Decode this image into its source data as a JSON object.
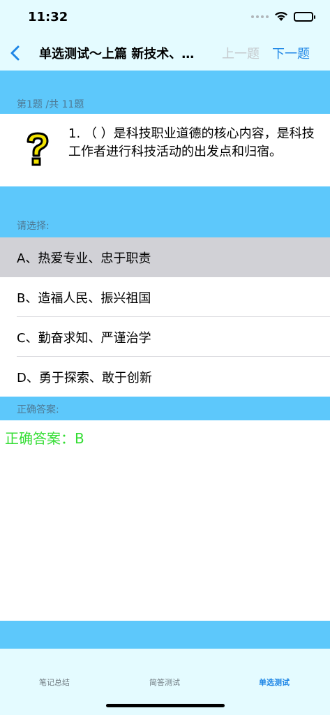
{
  "status": {
    "time": "11:32"
  },
  "nav": {
    "title": "单选测试～上篇 新技术、…",
    "prev_label": "上一题",
    "next_label": "下一题"
  },
  "question": {
    "progress": "第1题 /共 11题",
    "text": "1. （ ）是科技职业道德的核心内容，是科技工作者进行科技活动的出发点和归宿。"
  },
  "options": {
    "header": "请选择:",
    "items": [
      {
        "label": "A、热爱专业、忠于职责"
      },
      {
        "label": "B、造福人民、振兴祖国"
      },
      {
        "label": "C、勤奋求知、严谨治学"
      },
      {
        "label": "D、勇于探索、敢于创新"
      }
    ]
  },
  "answer": {
    "header": "正确答案:",
    "text": "正确答案：B"
  },
  "tabs": [
    {
      "label": "笔记总结"
    },
    {
      "label": "简答测试"
    },
    {
      "label": "单选测试"
    }
  ],
  "colors": {
    "accent": "#1e86e6",
    "band": "#5dc8fb",
    "answer": "#33dd33",
    "selected_row": "#d1d1d6"
  }
}
